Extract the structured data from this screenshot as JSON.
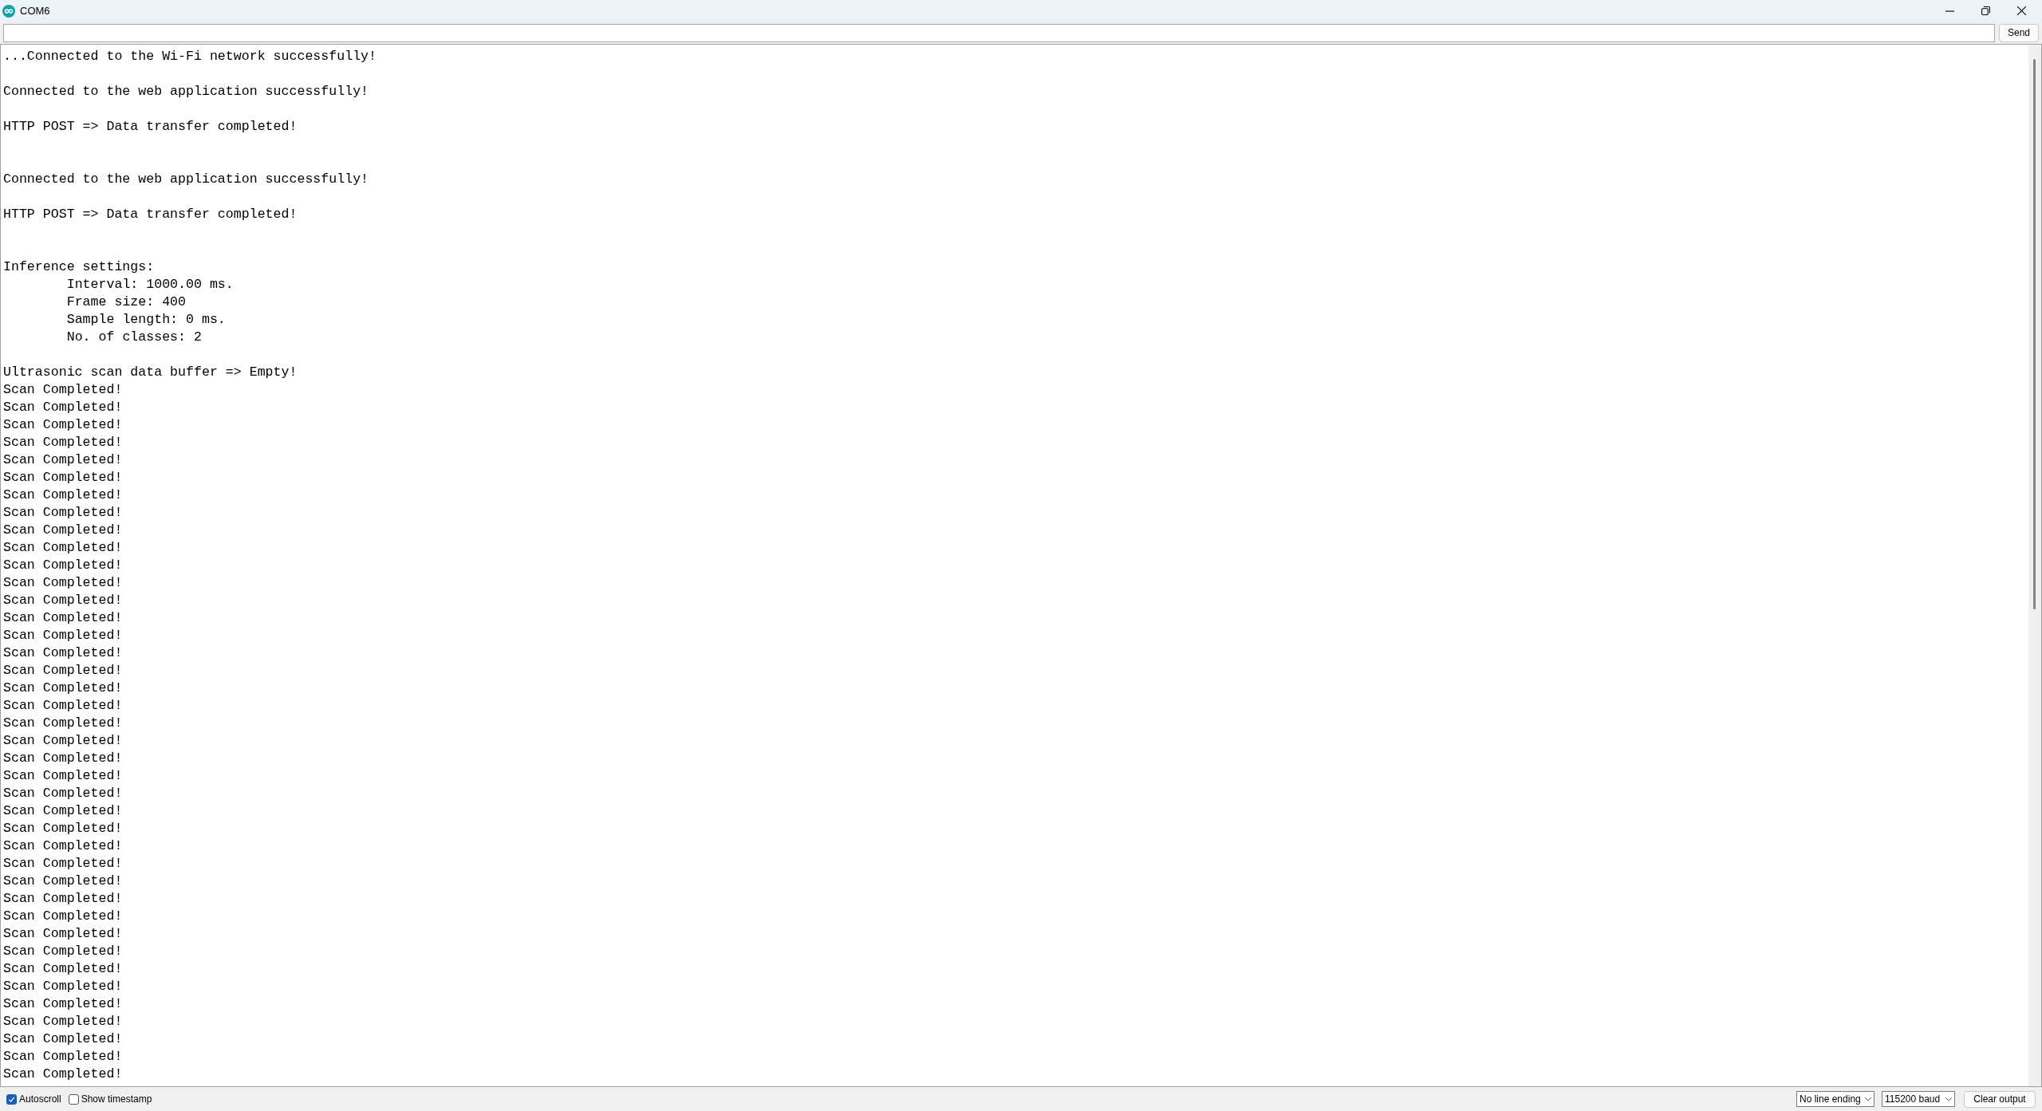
{
  "window": {
    "title": "COM6"
  },
  "send_button": "Send",
  "output": [
    {
      "kind": "text",
      "text": "...Connected to the Wi-Fi network successfully!"
    },
    {
      "kind": "blank"
    },
    {
      "kind": "text",
      "text": "Connected to the web application successfully!"
    },
    {
      "kind": "blank"
    },
    {
      "kind": "text",
      "text": "HTTP POST => Data transfer completed!"
    },
    {
      "kind": "blank"
    },
    {
      "kind": "blank"
    },
    {
      "kind": "text",
      "text": "Connected to the web application successfully!"
    },
    {
      "kind": "blank"
    },
    {
      "kind": "text",
      "text": "HTTP POST => Data transfer completed!"
    },
    {
      "kind": "blank"
    },
    {
      "kind": "blank"
    },
    {
      "kind": "text",
      "text": "Inference settings:"
    },
    {
      "kind": "text",
      "text": "\tInterval: 1000.00 ms."
    },
    {
      "kind": "text",
      "text": "\tFrame size: 400"
    },
    {
      "kind": "text",
      "text": "\tSample length: 0 ms."
    },
    {
      "kind": "text",
      "text": "\tNo. of classes: 2"
    },
    {
      "kind": "blank"
    },
    {
      "kind": "text",
      "text": "Ultrasonic scan data buffer => Empty!"
    },
    {
      "kind": "text",
      "text": "Scan Completed!"
    },
    {
      "kind": "text",
      "text": "Scan Completed!"
    },
    {
      "kind": "text",
      "text": "Scan Completed!"
    },
    {
      "kind": "text",
      "text": "Scan Completed!"
    },
    {
      "kind": "text",
      "text": "Scan Completed!"
    },
    {
      "kind": "text",
      "text": "Scan Completed!"
    },
    {
      "kind": "text",
      "text": "Scan Completed!"
    },
    {
      "kind": "text",
      "text": "Scan Completed!"
    },
    {
      "kind": "text",
      "text": "Scan Completed!"
    },
    {
      "kind": "text",
      "text": "Scan Completed!"
    },
    {
      "kind": "text",
      "text": "Scan Completed!"
    },
    {
      "kind": "text",
      "text": "Scan Completed!"
    },
    {
      "kind": "text",
      "text": "Scan Completed!"
    },
    {
      "kind": "text",
      "text": "Scan Completed!"
    },
    {
      "kind": "text",
      "text": "Scan Completed!"
    },
    {
      "kind": "text",
      "text": "Scan Completed!"
    },
    {
      "kind": "text",
      "text": "Scan Completed!"
    },
    {
      "kind": "text",
      "text": "Scan Completed!"
    },
    {
      "kind": "text",
      "text": "Scan Completed!"
    },
    {
      "kind": "text",
      "text": "Scan Completed!"
    },
    {
      "kind": "text",
      "text": "Scan Completed!"
    },
    {
      "kind": "text",
      "text": "Scan Completed!"
    },
    {
      "kind": "text",
      "text": "Scan Completed!"
    },
    {
      "kind": "text",
      "text": "Scan Completed!"
    },
    {
      "kind": "text",
      "text": "Scan Completed!"
    },
    {
      "kind": "text",
      "text": "Scan Completed!"
    },
    {
      "kind": "text",
      "text": "Scan Completed!"
    },
    {
      "kind": "text",
      "text": "Scan Completed!"
    },
    {
      "kind": "text",
      "text": "Scan Completed!"
    },
    {
      "kind": "text",
      "text": "Scan Completed!"
    },
    {
      "kind": "text",
      "text": "Scan Completed!"
    },
    {
      "kind": "text",
      "text": "Scan Completed!"
    },
    {
      "kind": "text",
      "text": "Scan Completed!"
    },
    {
      "kind": "text",
      "text": "Scan Completed!"
    },
    {
      "kind": "text",
      "text": "Scan Completed!"
    },
    {
      "kind": "text",
      "text": "Scan Completed!"
    },
    {
      "kind": "text",
      "text": "Scan Completed!"
    },
    {
      "kind": "text",
      "text": "Scan Completed!"
    },
    {
      "kind": "text",
      "text": "Scan Completed!"
    },
    {
      "kind": "text",
      "text": "Scan Completed!"
    }
  ],
  "footer": {
    "checkboxes": [
      {
        "label": "Autoscroll",
        "checked": true
      },
      {
        "label": "Show timestamp",
        "checked": false
      }
    ],
    "line_ending": "No line ending",
    "baud_rate": "115200 baud",
    "clear_button": "Clear output"
  }
}
